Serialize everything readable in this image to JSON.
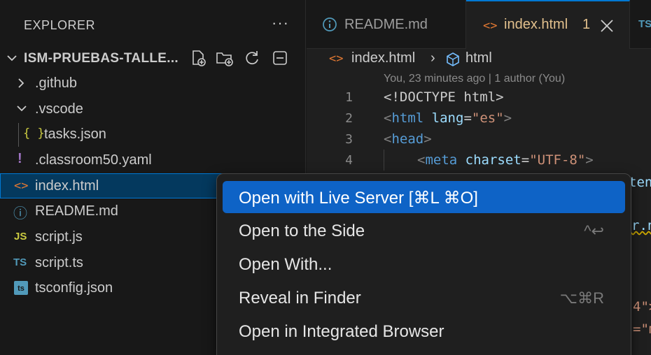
{
  "explorer": {
    "title": "EXPLORER",
    "more": "···",
    "folder": "ISM-PRUEBAS-TALLE...",
    "items": [
      {
        "label": ".github",
        "icon": "chevron-right-icon",
        "glyph": "›"
      },
      {
        "label": ".vscode",
        "icon": "chevron-down-icon",
        "glyph": "⌄"
      },
      {
        "label": "tasks.json",
        "icon": "json-file-icon",
        "glyph": "{ }"
      },
      {
        "label": ".classroom50.yaml",
        "icon": "yaml-file-icon",
        "glyph": "!"
      },
      {
        "label": "index.html",
        "icon": "html-file-icon",
        "glyph": "<>"
      },
      {
        "label": "README.md",
        "icon": "info-icon",
        "glyph": "ⓘ"
      },
      {
        "label": "script.js",
        "icon": "js-file-icon",
        "glyph": "JS"
      },
      {
        "label": "script.ts",
        "icon": "ts-file-icon",
        "glyph": "TS"
      },
      {
        "label": "tsconfig.json",
        "icon": "tsconfig-file-icon",
        "glyph": "ts"
      }
    ]
  },
  "tabs": {
    "readme": {
      "label": "README.md"
    },
    "index": {
      "label": "index.html",
      "badge": "1"
    },
    "ts": {
      "label": "TS"
    }
  },
  "breadcrumb": {
    "file": "index.html",
    "separator": "›",
    "symbol": "html"
  },
  "editor": {
    "blame": "You, 23 minutes ago | 1 author (You)",
    "line_numbers": [
      "1",
      "2",
      "3",
      "4"
    ],
    "line1": {
      "text": "<!DOCTYPE html>"
    },
    "line2": {
      "open": "<",
      "tag": "html",
      "attr": "lang",
      "eq": "=",
      "val": "\"es\"",
      "close": ">"
    },
    "line3": {
      "open": "<",
      "tag": "head",
      "close": ">"
    },
    "line4": {
      "open": "<",
      "tag": "meta",
      "attr": "charset",
      "eq": "=",
      "val": "\"UTF-8\"",
      "close": ">"
    },
    "peek": [
      "ten",
      "r.n",
      "4\">",
      "=\"m"
    ]
  },
  "context_menu": {
    "items": [
      {
        "label": "Open with Live Server [⌘L ⌘O]",
        "shortcut": ""
      },
      {
        "label": "Open to the Side",
        "shortcut": "^↩"
      },
      {
        "label": "Open With...",
        "shortcut": ""
      },
      {
        "label": "Reveal in Finder",
        "shortcut": "⌥⌘R"
      },
      {
        "label": "Open in Integrated Browser",
        "shortcut": ""
      }
    ]
  },
  "colors": {
    "accent": "#0078d4",
    "menu_highlight": "#0e63c6",
    "html_icon": "#e37933",
    "json_icon": "#cbcb41",
    "yaml_icon": "#a074c4",
    "info_icon": "#519aba"
  }
}
